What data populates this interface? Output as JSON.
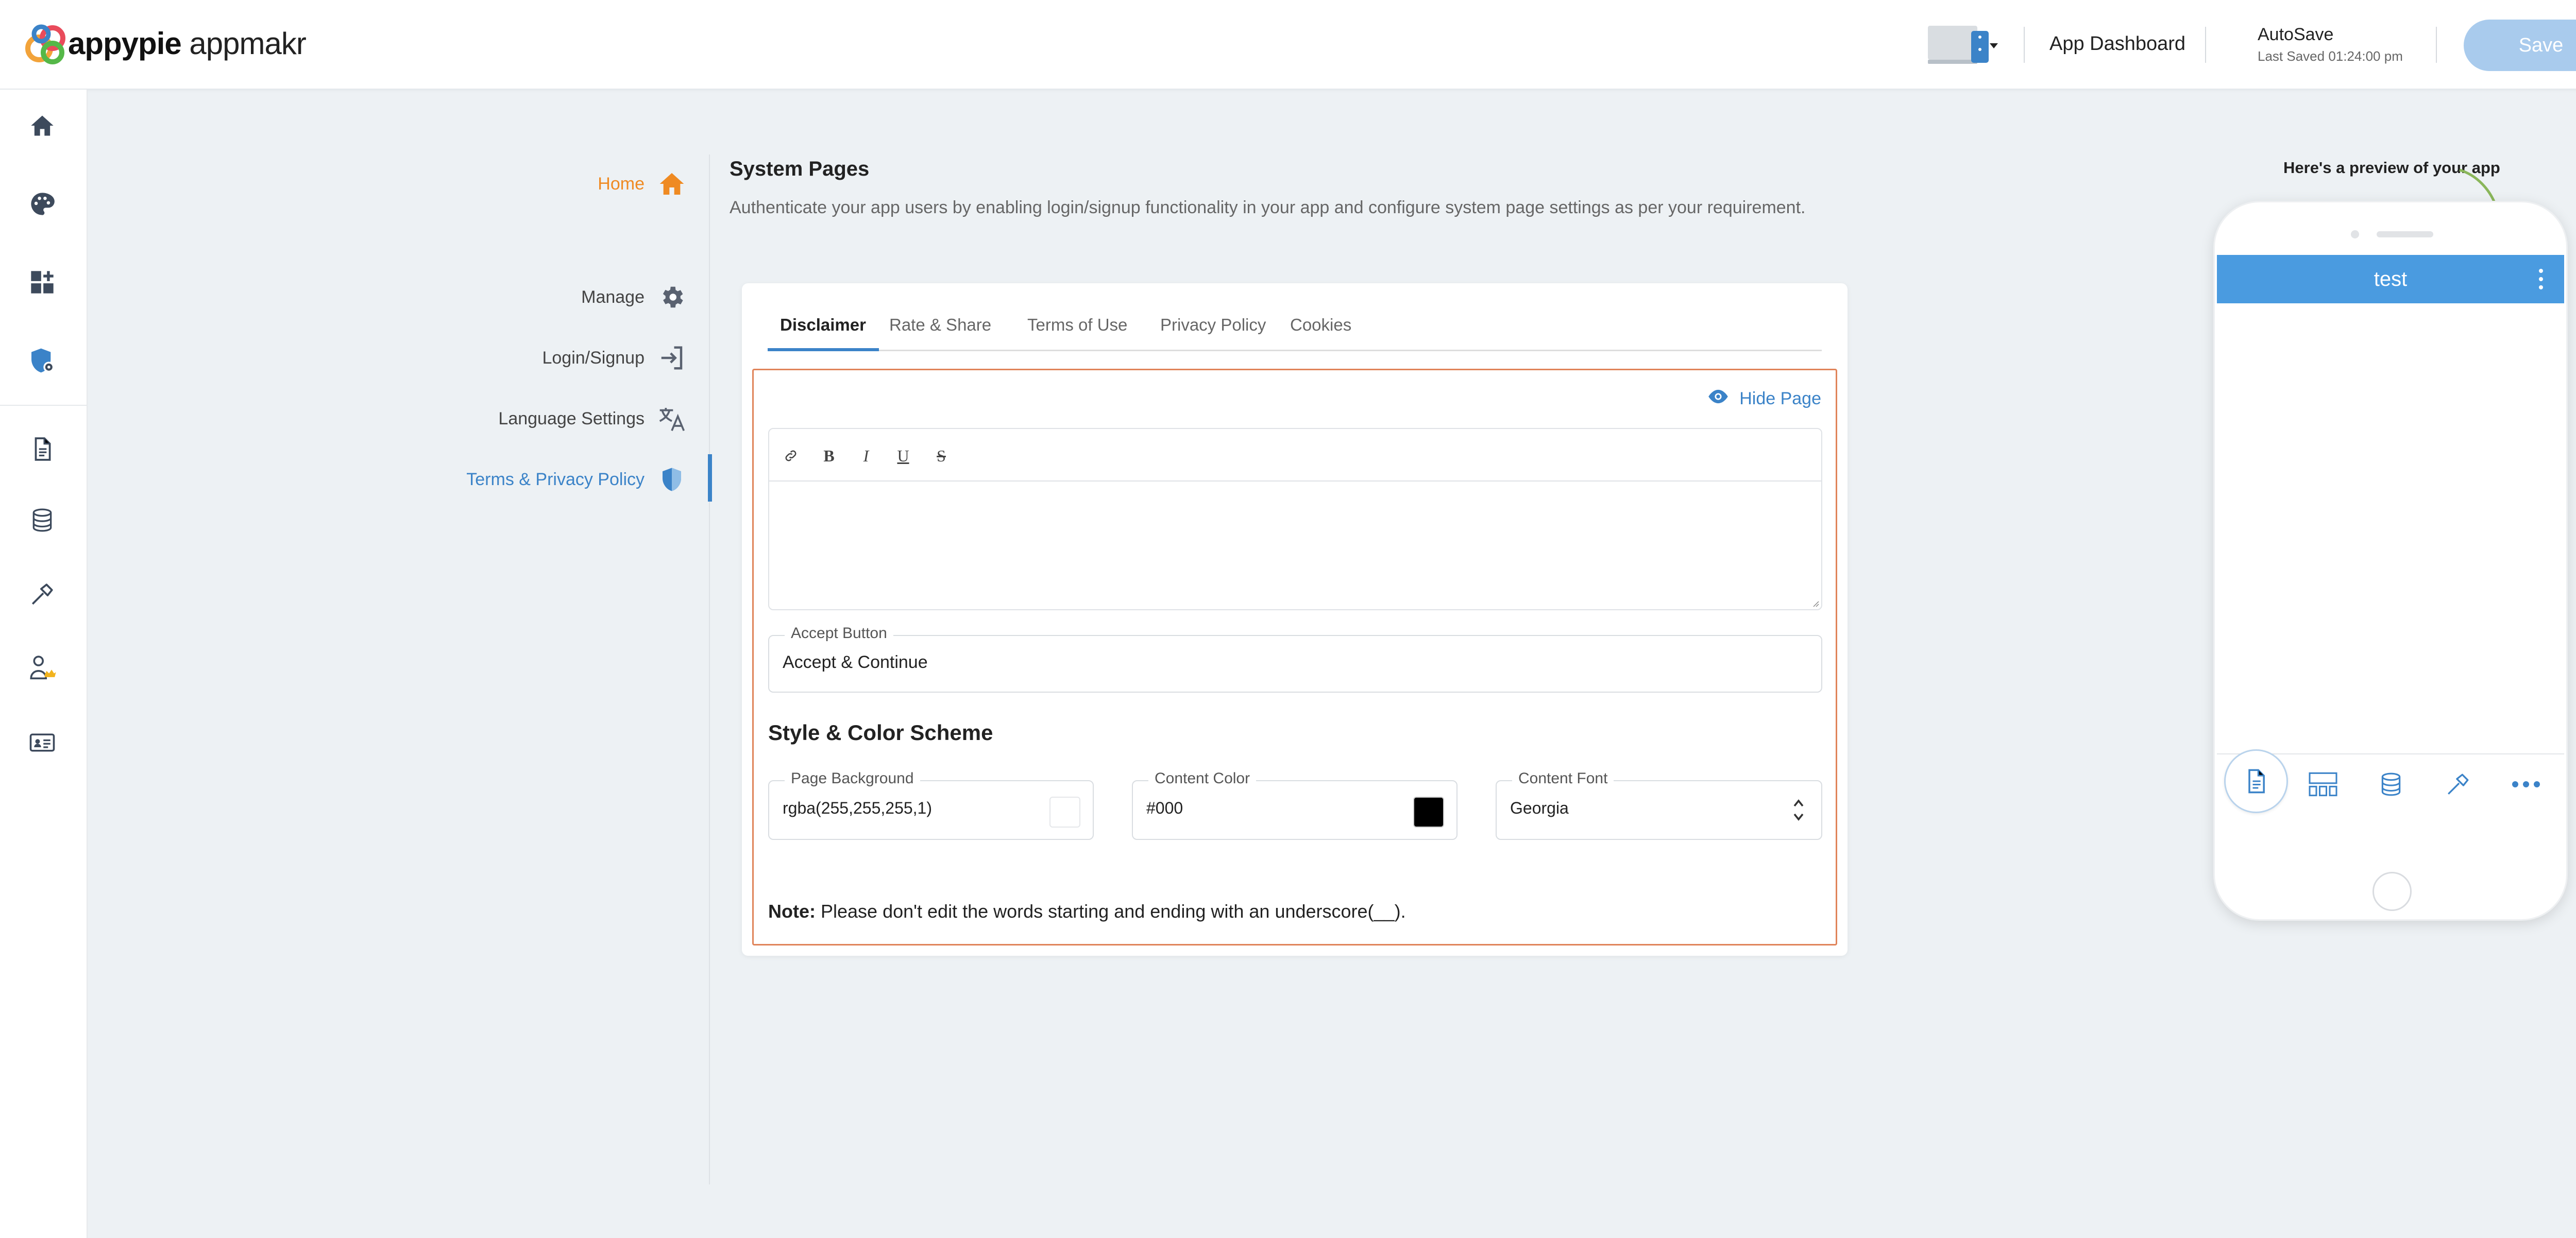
{
  "header": {
    "brand_name": "appypie",
    "brand_suffix": " appmakr",
    "app_dashboard": "App Dashboard",
    "autosave": "AutoSave",
    "last_saved": "Last Saved 01:24:00 pm",
    "save_label": "Save"
  },
  "rail": {
    "icons": [
      "home-icon",
      "palette-icon",
      "add-widget-icon",
      "shield-gear-icon",
      "document-icon",
      "database-icon",
      "hammer-icon",
      "person-crown-icon",
      "id-card-icon"
    ]
  },
  "subnav": {
    "items": [
      {
        "label": "Home",
        "icon": "home-icon"
      },
      {
        "label": "Manage",
        "icon": "gear-icon"
      },
      {
        "label": "Login/Signup",
        "icon": "login-icon"
      },
      {
        "label": "Language Settings",
        "icon": "translate-icon"
      },
      {
        "label": "Terms & Privacy Policy",
        "icon": "shield-icon"
      }
    ]
  },
  "main": {
    "title": "System Pages",
    "description": "Authenticate your app users by enabling login/signup functionality in your app and configure system page settings as per your requirement.",
    "tabs": [
      {
        "label": "Disclaimer"
      },
      {
        "label": "Rate & Share"
      },
      {
        "label": "Terms of Use"
      },
      {
        "label": "Privacy Policy"
      },
      {
        "label": "Cookies"
      }
    ],
    "hide_page": "Hide Page",
    "editor": {
      "toolbar": [
        "link",
        "B",
        "I",
        "U",
        "S"
      ],
      "content": ""
    },
    "accept_button": {
      "legend": "Accept Button",
      "value": "Accept & Continue"
    },
    "style_title": "Style & Color Scheme",
    "page_background": {
      "legend": "Page Background",
      "value": "rgba(255,255,255,1)",
      "swatch": "#ffffff"
    },
    "content_color": {
      "legend": "Content Color",
      "value": "#000",
      "swatch": "#000000"
    },
    "content_font": {
      "legend": "Content Font",
      "value": "Georgia"
    },
    "note_label": "Note:",
    "note_text": " Please don't edit the words starting and ending with an underscore(__)."
  },
  "preview": {
    "label": "Here's a preview of your app",
    "app_title": "test",
    "bottom_nav": [
      "document-icon",
      "grid-icon",
      "database-icon",
      "hammer-icon",
      "more-icon"
    ]
  },
  "colors": {
    "accent": "#3b83c8",
    "home_orange": "#ef8a22",
    "editor_border": "#e0845a",
    "app_bar": "#4a9be0",
    "save_button": "#a9cbed"
  }
}
